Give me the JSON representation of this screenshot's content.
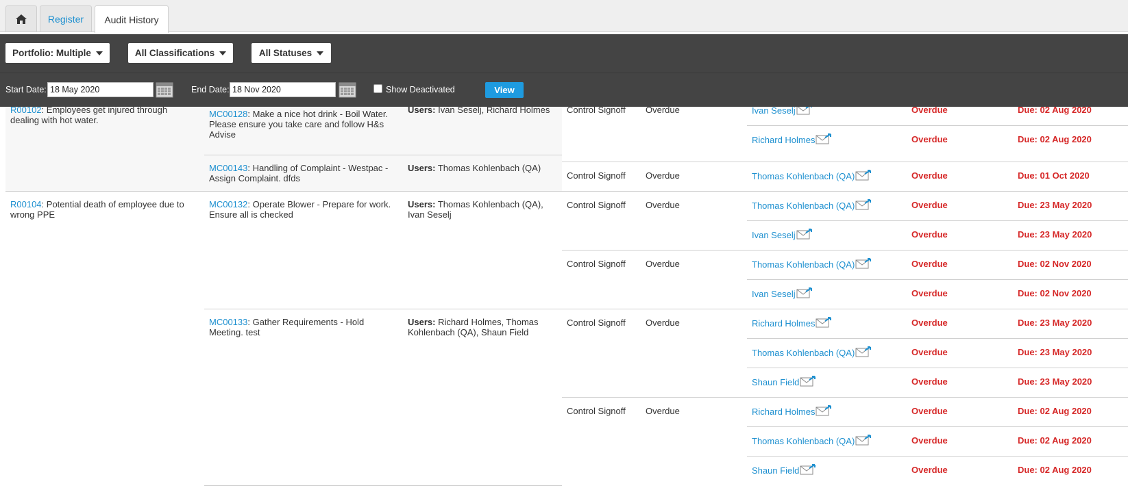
{
  "tabs": {
    "register": "Register",
    "audit_history": "Audit History"
  },
  "filters": {
    "portfolio": "Portfolio: Multiple",
    "classifications": "All Classifications",
    "statuses": "All Statuses",
    "start_label": "Start Date:",
    "start_value": "18 May 2020",
    "end_label": "End Date:",
    "end_value": "18 Nov 2020",
    "show_deactivated": "Show Deactivated",
    "view_button": "View"
  },
  "risks": [
    {
      "id": "R00102",
      "desc": "Employees get injured through dealing with hot water."
    },
    {
      "id": "R00104",
      "desc": "Potential death of employee due to wrong PPE"
    }
  ],
  "controls": [
    {
      "id": "MC00128",
      "desc": "Make a nice hot drink - Boil Water. Please ensure you take care and follow H&s Advise",
      "users_label": "Users:",
      "users": "Ivan Seselj, Richard Holmes"
    },
    {
      "id": "MC00143",
      "desc": "Handling of Complaint - Westpac - Assign Complaint. dfds",
      "users_label": "Users:",
      "users": "Thomas Kohlenbach (QA)"
    },
    {
      "id": "MC00132",
      "desc": "Operate Blower - Prepare for work. Ensure all is checked",
      "users_label": "Users:",
      "users": "Thomas Kohlenbach (QA), Ivan Seselj"
    },
    {
      "id": "MC00133",
      "desc": "Gather Requirements - Hold Meeting. test",
      "users_label": "Users:",
      "users": "Richard Holmes, Thomas Kohlenbach (QA), Shaun Field"
    }
  ],
  "signoffs": [
    {
      "type": "Control Signoff",
      "status": "Overdue"
    },
    {
      "type": "Control Signoff",
      "status": "Overdue"
    },
    {
      "type": "Control Signoff",
      "status": "Overdue"
    },
    {
      "type": "Control Signoff",
      "status": "Overdue"
    },
    {
      "type": "Control Signoff",
      "status": "Overdue"
    },
    {
      "type": "Control Signoff",
      "status": "Overdue"
    }
  ],
  "assignments": [
    {
      "user": "Ivan Seselj",
      "status": "Overdue",
      "due": "Due: 02 Aug 2020"
    },
    {
      "user": "Richard Holmes",
      "status": "Overdue",
      "due": "Due: 02 Aug 2020"
    },
    {
      "user": "Thomas Kohlenbach (QA)",
      "status": "Overdue",
      "due": "Due: 01 Oct 2020"
    },
    {
      "user": "Thomas Kohlenbach (QA)",
      "status": "Overdue",
      "due": "Due: 23 May 2020"
    },
    {
      "user": "Ivan Seselj",
      "status": "Overdue",
      "due": "Due: 23 May 2020"
    },
    {
      "user": "Thomas Kohlenbach (QA)",
      "status": "Overdue",
      "due": "Due: 02 Nov 2020"
    },
    {
      "user": "Ivan Seselj",
      "status": "Overdue",
      "due": "Due: 02 Nov 2020"
    },
    {
      "user": "Richard Holmes",
      "status": "Overdue",
      "due": "Due: 23 May 2020"
    },
    {
      "user": "Thomas Kohlenbach (QA)",
      "status": "Overdue",
      "due": "Due: 23 May 2020"
    },
    {
      "user": "Shaun Field",
      "status": "Overdue",
      "due": "Due: 23 May 2020"
    },
    {
      "user": "Richard Holmes",
      "status": "Overdue",
      "due": "Due: 02 Aug 2020"
    },
    {
      "user": "Thomas Kohlenbach (QA)",
      "status": "Overdue",
      "due": "Due: 02 Aug 2020"
    },
    {
      "user": "Shaun Field",
      "status": "Overdue",
      "due": "Due: 02 Aug 2020"
    }
  ],
  "colors": {
    "link": "#1e90d0",
    "overdue": "#d62828",
    "toolbar": "#444444",
    "view_button": "#1e9be0"
  }
}
